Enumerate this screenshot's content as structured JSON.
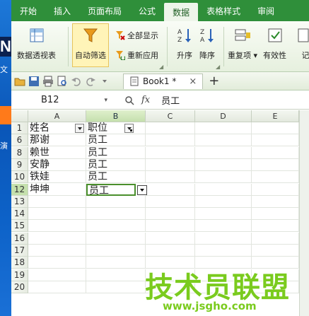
{
  "desktop": {
    "n": "N",
    "w": "文",
    "t": "演"
  },
  "tabs": [
    "开始",
    "插入",
    "页面布局",
    "公式",
    "数据",
    "表格样式",
    "审阅"
  ],
  "active_tab": "数据",
  "ribbon": {
    "pivot": "数据透视表",
    "autofilter": "自动筛选",
    "show_all": "全部显示",
    "reapply": "重新应用",
    "asc": "升序",
    "desc": "降序",
    "duplicates": "重复项",
    "validity": "有效性",
    "more": "记"
  },
  "doc": {
    "name": "Book1 *",
    "close": "×",
    "add": "+"
  },
  "formula": {
    "cellref": "B12",
    "fx": "fx",
    "value": "员工"
  },
  "columns": [
    "A",
    "B",
    "C",
    "D",
    "E"
  ],
  "rows": [
    {
      "num": "1",
      "a": "姓名",
      "b": "职位"
    },
    {
      "num": "6",
      "a": "那谢",
      "b": "员工"
    },
    {
      "num": "8",
      "a": "赖世",
      "b": "员工"
    },
    {
      "num": "9",
      "a": "安静",
      "b": "员工"
    },
    {
      "num": "10",
      "a": "铁娃",
      "b": "员工"
    },
    {
      "num": "12",
      "a": "坤坤",
      "b": "员工"
    },
    {
      "num": "13",
      "a": "",
      "b": ""
    },
    {
      "num": "14",
      "a": "",
      "b": ""
    },
    {
      "num": "15",
      "a": "",
      "b": ""
    },
    {
      "num": "16",
      "a": "",
      "b": ""
    },
    {
      "num": "17",
      "a": "",
      "b": ""
    },
    {
      "num": "18",
      "a": "",
      "b": ""
    },
    {
      "num": "19",
      "a": "",
      "b": ""
    },
    {
      "num": "20",
      "a": "",
      "b": ""
    }
  ],
  "watermark": {
    "text": "技术员联盟",
    "url": "www.jsgho.com"
  },
  "colors": {
    "ribbon_green": "#2f8f3a",
    "active_border": "#4a8f2c",
    "watermark": "#7acb1e"
  }
}
